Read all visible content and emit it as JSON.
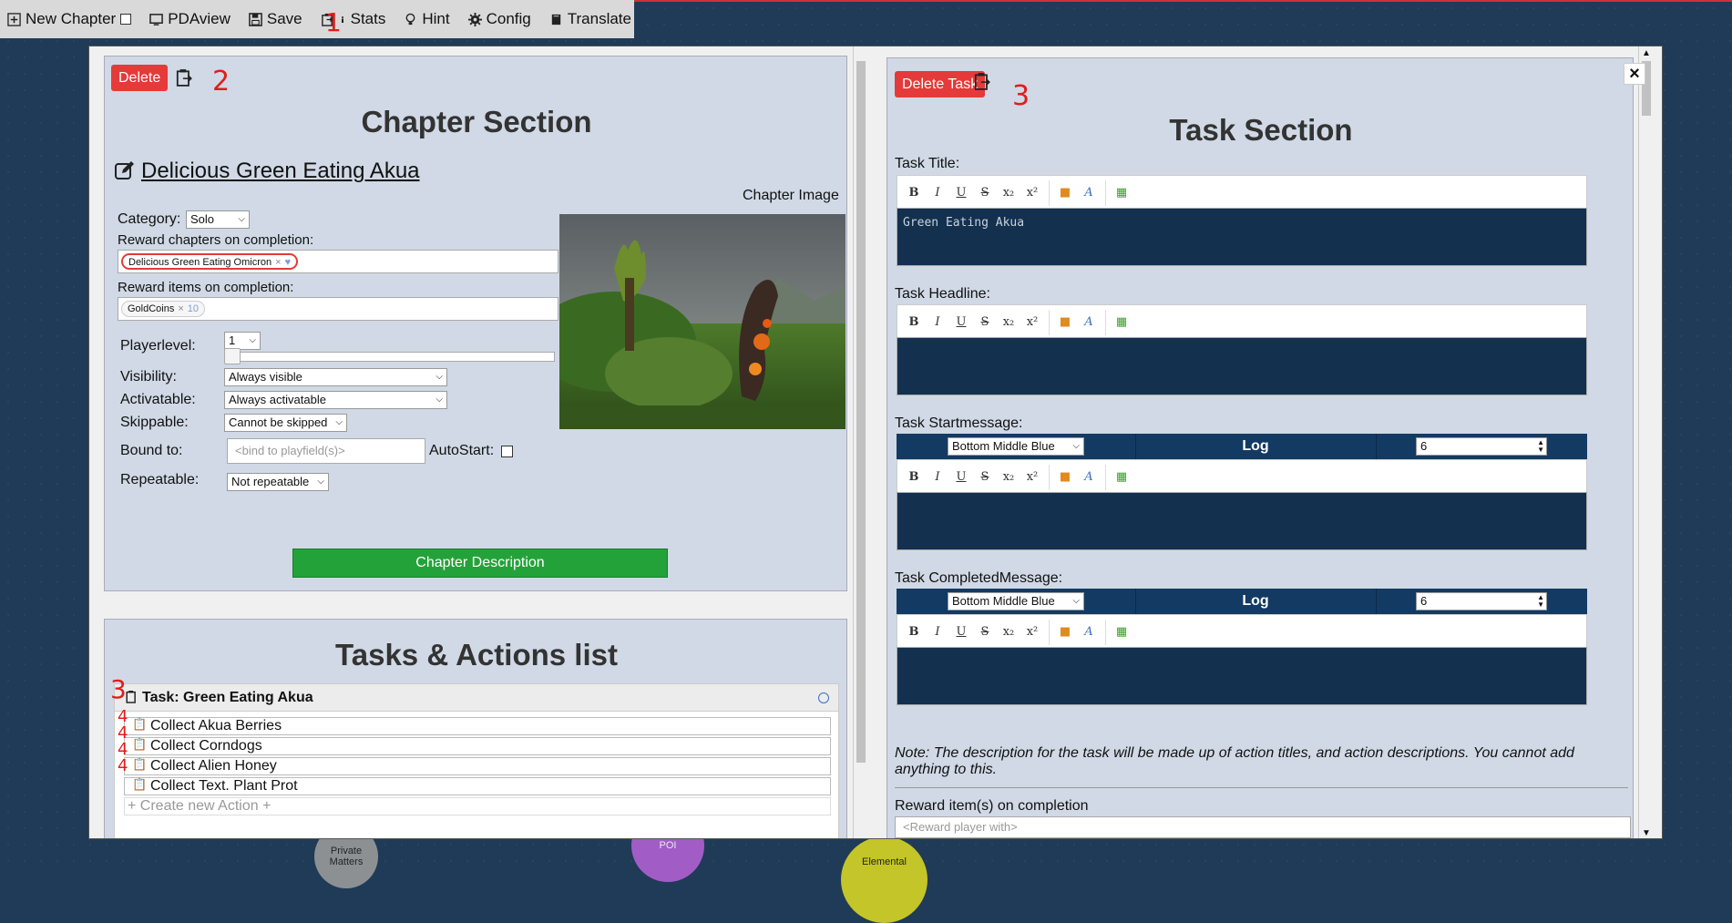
{
  "toolbar": {
    "items": [
      {
        "label": "New Chapter",
        "icon": "plus-square-icon"
      },
      {
        "label": "PDAview",
        "icon": "tv-icon"
      },
      {
        "label": "Save",
        "icon": "floppy-icon"
      },
      {
        "label": "Stats",
        "icon": "info-icon"
      },
      {
        "label": "Hint",
        "icon": "lightbulb-icon"
      },
      {
        "label": "Config",
        "icon": "gear-icon"
      },
      {
        "label": "Translate",
        "icon": "book-icon"
      }
    ]
  },
  "annotations": {
    "one": "1",
    "two": "2",
    "three_a": "3",
    "three_b": "3",
    "four": "4"
  },
  "chapter": {
    "delete_label": "Delete",
    "section_title": "Chapter Section",
    "name": "Delicious Green Eating Akua",
    "category_label": "Category:",
    "category_value": "Solo",
    "reward_chapters_label": "Reward chapters on completion:",
    "reward_chapter_tag": "Delicious Green Eating Omicron",
    "reward_items_label": "Reward items on completion:",
    "reward_item_tag": "GoldCoins",
    "reward_item_count": "10",
    "playerlevel_label": "Playerlevel:",
    "playerlevel_value": "1",
    "playerlevel_fraction": 0,
    "visibility_label": "Visibility:",
    "visibility_value": "Always visible",
    "activatable_label": "Activatable:",
    "activatable_value": "Always activatable",
    "skippable_label": "Skippable:",
    "skippable_value": "Cannot be skipped",
    "bound_label": "Bound to:",
    "bound_placeholder": "<bind to playfield(s)>",
    "autostart_label": "AutoStart:",
    "repeatable_label": "Repeatable:",
    "repeatable_value": "Not repeatable",
    "image_label": "Chapter Image",
    "description_button": "Chapter Description"
  },
  "tasks_list": {
    "title": "Tasks & Actions list",
    "task_label": "Task: Green Eating Akua",
    "actions": [
      "Collect Akua Berries",
      "Collect Corndogs",
      "Collect Alien Honey",
      "Collect Text. Plant Prot"
    ],
    "create_action": "+ Create new Action +"
  },
  "task": {
    "delete_label": "Delete Task",
    "section_title": "Task Section",
    "title_label": "Task Title:",
    "title_value": "Green Eating Akua",
    "headline_label": "Task Headline:",
    "startmessage_label": "Task Startmessage:",
    "completed_label": "Task CompletedMessage:",
    "message_position": "Bottom Middle Blue",
    "message_log": "Log",
    "message_duration": "6",
    "note": "Note: The description for the task will be made up of action titles, and action descriptions. You cannot add anything to this.",
    "reward_label": "Reward item(s) on completion",
    "reward_placeholder": "<Reward player with>"
  },
  "editor_buttons": [
    "B",
    "I",
    "U",
    "S",
    "x₂",
    "x²"
  ],
  "background": {
    "bubbles": [
      "Private Matters",
      "POI",
      "Elemental"
    ]
  },
  "colors": {
    "red": "#e53a3a",
    "green": "#24a23a",
    "editor_bg": "#13304f",
    "msg_bar": "#133a63"
  }
}
